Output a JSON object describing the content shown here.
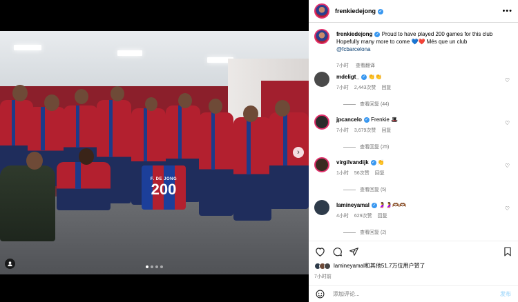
{
  "post": {
    "username": "frenkiedejong",
    "caption_line1": "Proud to have played 200 games for this club",
    "caption_line2": "Hopefully many more to come 💙❤️ Més que un club",
    "caption_mention": "@fcbarcelona",
    "caption_time": "7小时",
    "caption_translate": "查看翻译",
    "jersey_name": "F. DE JONG",
    "jersey_number": "200"
  },
  "comments": [
    {
      "user": "mdeligt_",
      "text": "👏👏",
      "time": "7小时",
      "likes": "2,443次赞",
      "reply": "回复",
      "view_replies": "查看回复 (44)",
      "color": "#4a4a4a"
    },
    {
      "user": "jpcancelo",
      "text": "Frenkie 🎩",
      "time": "7小时",
      "likes": "3,679次赞",
      "reply": "回复",
      "view_replies": "查看回复 (25)",
      "color": "#2b2b2b"
    },
    {
      "user": "virgilvandijk",
      "text": "👏",
      "time": "1小时",
      "likes": "56次赞",
      "reply": "回复",
      "view_replies": "查看回复 (5)",
      "color": "#3a2a20"
    },
    {
      "user": "lamineyamal",
      "text": "🤰🤰🫶🏾🫶🏾",
      "time": "4小时",
      "likes": "629次赞",
      "reply": "回复",
      "view_replies": "查看回复 (2)",
      "color": "#2e3b4a"
    }
  ],
  "likes_summary": "lamineyamal和其他51.7万位用户赞了",
  "post_time": "7小时前",
  "comment_placeholder": "添加评论...",
  "post_button": "发布",
  "icons": {
    "heart": "heart-icon",
    "comment": "comment-icon",
    "share": "share-icon",
    "save": "bookmark-icon",
    "emoji": "emoji-icon",
    "more": "more-icon"
  },
  "colors": {
    "accent": "#3897f0",
    "link": "#00376b",
    "muted": "#737373"
  }
}
